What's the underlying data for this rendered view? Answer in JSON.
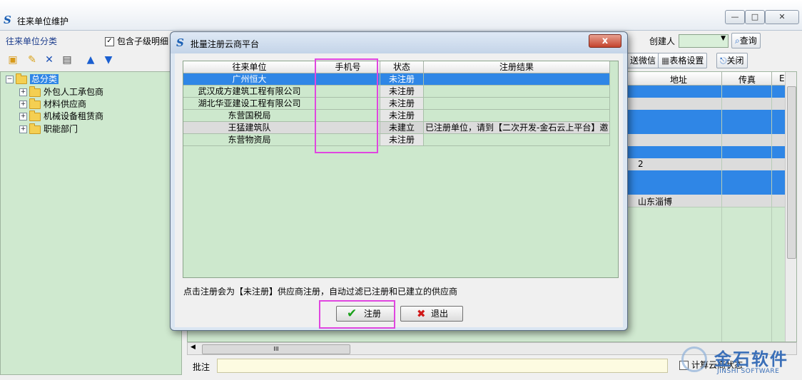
{
  "main_window": {
    "title": "往来单位维护",
    "controls": {
      "minimize": "—",
      "maximize": "□",
      "close": "✕"
    }
  },
  "left_panel": {
    "header_label": "往来单位分类",
    "include_children": {
      "label": "包含子级明细",
      "checked": true
    }
  },
  "toolbar": {
    "creator_label": "创建人",
    "query_button": "查询",
    "send_wechat_button": "送微信",
    "table_settings_button": "表格设置",
    "close_button": "关闭"
  },
  "tree": {
    "root": "总分类",
    "children": [
      "外包人工承包商",
      "材料供应商",
      "机械设备租赁商",
      "职能部门"
    ]
  },
  "main_grid": {
    "columns": {
      "address": "地址",
      "fax": "传真",
      "extra": "E"
    },
    "visible_values": {
      "row_7_address": "2",
      "row_10_address": "山东淄博"
    }
  },
  "bottom": {
    "note_label": "批注",
    "scroll_thumb": "III",
    "calc_button": "计算云商状态"
  },
  "watermark": {
    "cn": "金石软件",
    "en": "JINSHI SOFTWARE"
  },
  "dialog": {
    "title": "批量注册云商平台",
    "close_glyph": "x",
    "columns": {
      "unit": "往来单位",
      "phone": "手机号",
      "status": "状态",
      "result": "注册结果"
    },
    "rows": [
      {
        "unit": "广州恒大",
        "phone": "",
        "status": "未注册",
        "result": "",
        "selected": true
      },
      {
        "unit": "武汉成方建筑工程有限公司",
        "phone": "",
        "status": "未注册",
        "result": ""
      },
      {
        "unit": "湖北华亚建设工程有限公司",
        "phone": "",
        "status": "未注册",
        "result": ""
      },
      {
        "unit": "东营国税局",
        "phone": "",
        "status": "未注册",
        "result": ""
      },
      {
        "unit": "王猛建筑队",
        "phone": "",
        "status": "未建立",
        "result": "已注册单位，请到【二次开发-金石云上平台】邀"
      },
      {
        "unit": "东营物资局",
        "phone": "",
        "status": "未注册",
        "result": ""
      }
    ],
    "hint": "点击注册会为【未注册】供应商注册，自动过滤已注册和已建立的供应商",
    "register_button": "注册",
    "exit_button": "退出"
  },
  "colors": {
    "selection": "#2f86e6",
    "grid_bg": "#cde8cd",
    "highlight": "#e046e0"
  }
}
